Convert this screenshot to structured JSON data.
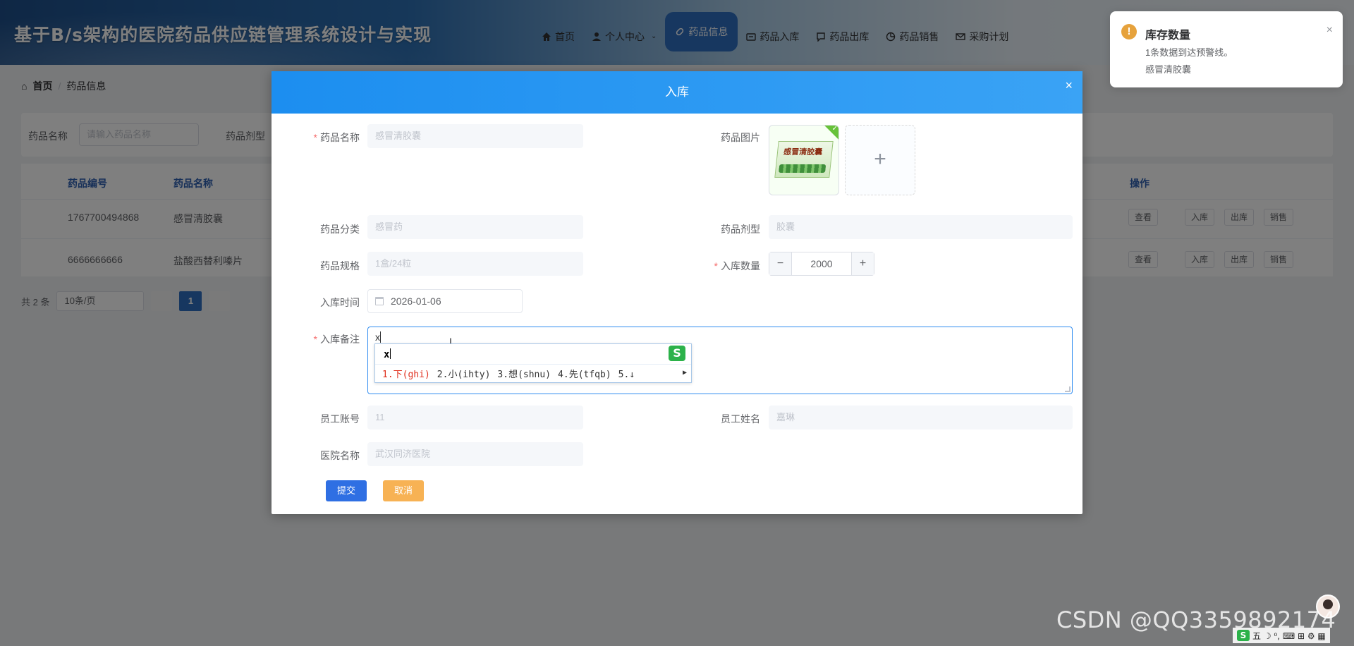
{
  "app": {
    "title": "基于B/s架构的医院药品供应链管理系统设计与实现"
  },
  "topnav": [
    {
      "label": "首页",
      "icon": "home-icon"
    },
    {
      "label": "个人中心",
      "icon": "user-icon"
    },
    {
      "label": "药品信息",
      "icon": "pill-icon"
    },
    {
      "label": "药品入库",
      "icon": "stock-in-icon"
    },
    {
      "label": "药品出库",
      "icon": "stock-out-icon"
    },
    {
      "label": "药品销售",
      "icon": "pie-chart-icon"
    },
    {
      "label": "采购计划",
      "icon": "mail-icon"
    }
  ],
  "breadcrumb": {
    "home": "首页",
    "sep": "/",
    "current": "药品信息"
  },
  "search": {
    "name_label": "药品名称",
    "name_placeholder": "请输入药品名称",
    "form_label": "药品剂型"
  },
  "table": {
    "headers": {
      "code": "药品编号",
      "name": "药品名称",
      "ops": "操作"
    },
    "rows": [
      {
        "code": "1767700494868",
        "name": "感冒清胶囊"
      },
      {
        "code": "6666666666",
        "name": "盐酸西替利嗪片"
      }
    ],
    "ops": {
      "view": "查看",
      "in": "入库",
      "out": "出库",
      "sell": "销售"
    }
  },
  "pager": {
    "total": "共 2 条",
    "page_size": "10条/页",
    "current_page": "1"
  },
  "notification": {
    "title": "库存数量",
    "line1": "1条数据到达预警线。",
    "line2": "感冒清胶囊",
    "close": "×"
  },
  "dialog": {
    "title": "入库",
    "close": "×",
    "fields": {
      "drug_name": {
        "label": "药品名称",
        "value": "感冒清胶囊"
      },
      "drug_image": {
        "label": "药品图片",
        "image_text": "感冒清胶囊",
        "upload_plus": "+"
      },
      "category": {
        "label": "药品分类",
        "value": "感冒药"
      },
      "form": {
        "label": "药品剂型",
        "value": "胶囊"
      },
      "spec": {
        "label": "药品规格",
        "value": "1盒/24粒"
      },
      "quantity": {
        "label": "入库数量",
        "value": "2000",
        "minus": "−",
        "plus": "+"
      },
      "in_time": {
        "label": "入库时间",
        "value": "2026-01-06"
      },
      "remark": {
        "label": "入库备注",
        "value": "x"
      },
      "staff_account": {
        "label": "员工账号",
        "value": "11"
      },
      "staff_name": {
        "label": "员工姓名",
        "value": "嘉琳"
      },
      "hospital": {
        "label": "医院名称",
        "value": "武汉同济医院"
      }
    },
    "submit": "提交",
    "cancel": "取消"
  },
  "ime": {
    "composition": "x",
    "logo": "S",
    "candidates": [
      "1.下(ghi)",
      "2.小(ihty)",
      "3.想(shnu)",
      "4.先(tfqb)",
      "5.↓"
    ],
    "more": "▶"
  },
  "watermark": "CSDN @QQ3359892174",
  "tray": {
    "s": "S",
    "items": "五 ☽ ⁰, ⌨ ⊞ ⚙ ▦"
  }
}
